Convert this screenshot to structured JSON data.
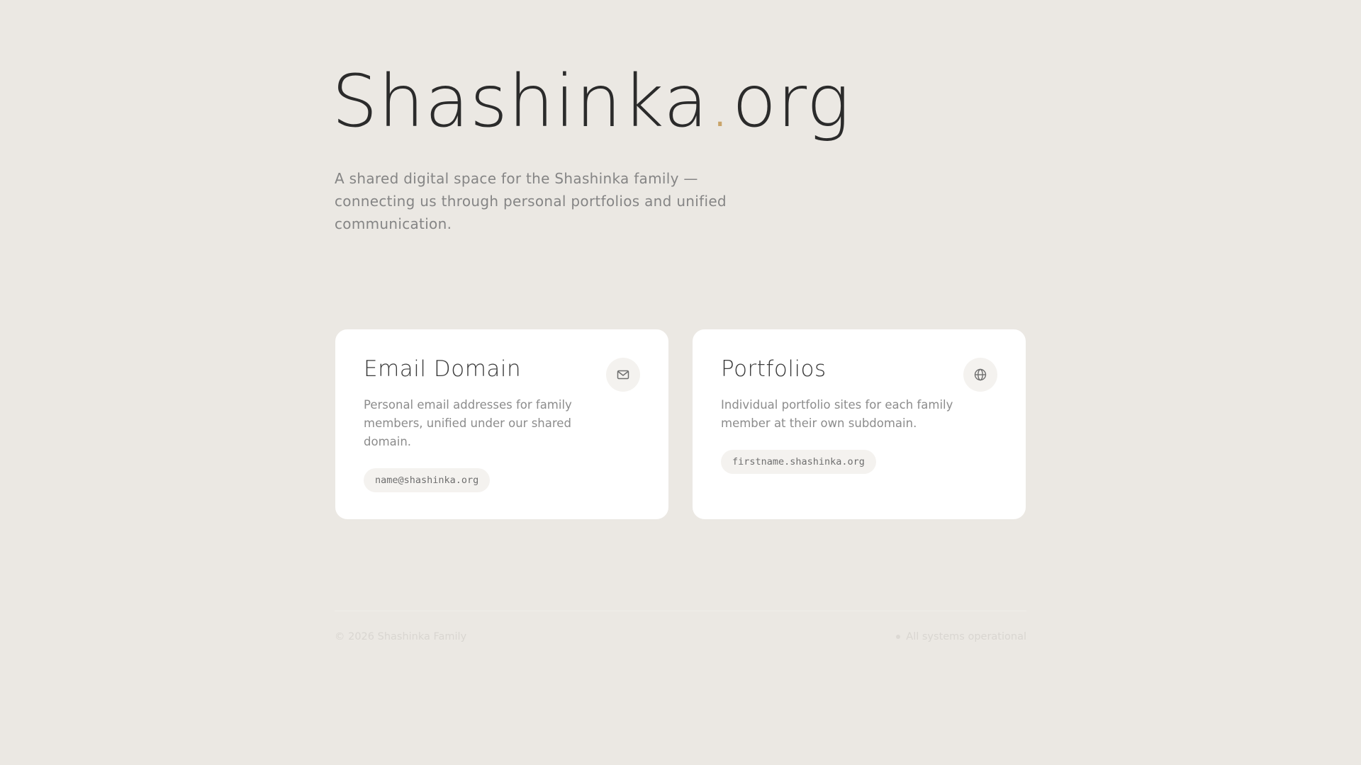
{
  "hero": {
    "title_main": "Shashinka",
    "title_dot": ".",
    "title_tld": "org",
    "tagline": "A shared digital space for the Shashinka family — connecting us through personal portfolios and unified communication."
  },
  "cards": [
    {
      "title": "Email Domain",
      "description": "Personal email addresses for family members, unified under our shared domain.",
      "chip": "name@shashinka.org",
      "icon": "mail-icon"
    },
    {
      "title": "Portfolios",
      "description": "Individual portfolio sites for each family member at their own subdomain.",
      "chip": "firstname.shashinka.org",
      "icon": "globe-icon"
    }
  ],
  "footer": {
    "copyright": "© 2026 Shashinka Family",
    "status": "All systems operational"
  },
  "colors": {
    "background": "#faf9f7",
    "accent": "#c9a46a",
    "text": "#2b2b2b",
    "muted": "#858585",
    "grid": "#ebe8e3"
  }
}
